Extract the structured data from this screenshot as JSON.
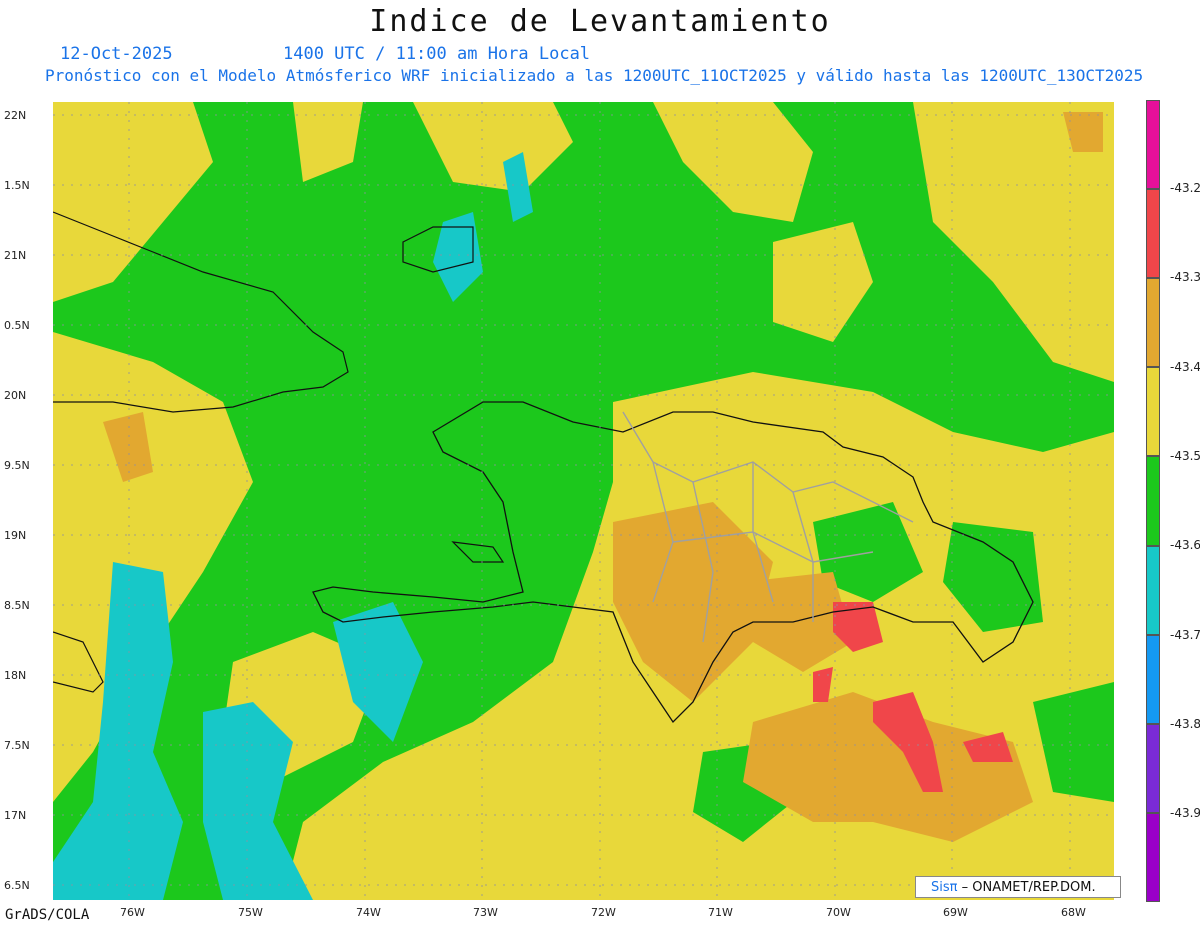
{
  "header": {
    "title": "Indice de Levantamiento",
    "date": "12-Oct-2025",
    "time": "1400 UTC / 11:00 am Hora Local",
    "description": "Pronóstico con el Modelo Atmósferico WRF inicializado a las 1200UTC_11OCT2025 y válido hasta las  1200UTC_13OCT2025"
  },
  "axes": {
    "y_ticks": [
      "22N",
      "1.5N",
      "21N",
      "0.5N",
      "20N",
      "9.5N",
      "19N",
      "8.5N",
      "18N",
      "7.5N",
      "17N",
      "6.5N"
    ],
    "x_ticks": [
      "76W",
      "75W",
      "74W",
      "73W",
      "72W",
      "71W",
      "70W",
      "69W",
      "68W"
    ]
  },
  "colorbar": {
    "labels": [
      "-43.2",
      "-43.3",
      "-43.4",
      "-43.5",
      "-43.6",
      "-43.7",
      "-43.8",
      "-43.9"
    ],
    "colors": [
      "#e6109a",
      "#f0464a",
      "#e2a830",
      "#e8d83a",
      "#1cc81c",
      "#17c8c8",
      "#1499f2",
      "#7a2bd6",
      "#9a00c8"
    ]
  },
  "footer": {
    "credit": "GrADS/COLA",
    "logo_mark": "Sisπ",
    "logo_text": "– ONAMET/REP.DOM."
  }
}
